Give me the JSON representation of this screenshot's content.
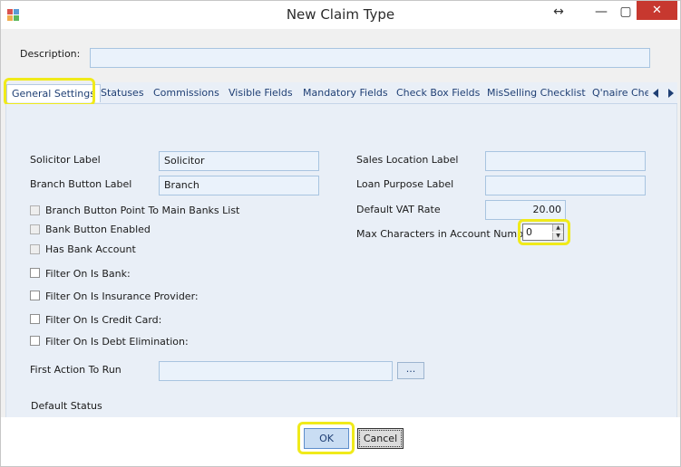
{
  "window": {
    "title": "New Claim Type",
    "resize_glyph": "↔",
    "minimize_glyph": "—",
    "maximize_glyph": "▢",
    "close_glyph": "✕"
  },
  "description": {
    "label": "Description:",
    "value": ""
  },
  "tabs": [
    {
      "label": "General Settings",
      "active": true
    },
    {
      "label": "Statuses"
    },
    {
      "label": "Commissions"
    },
    {
      "label": "Visible Fields"
    },
    {
      "label": "Mandatory Fields"
    },
    {
      "label": "Check Box Fields"
    },
    {
      "label": "MisSelling Checklist"
    },
    {
      "label": "Q'naire Chec"
    }
  ],
  "general": {
    "solicitor_label": {
      "label": "Solicitor Label",
      "value": "Solicitor"
    },
    "branch_button_label": {
      "label": "Branch Button Label",
      "value": "Branch"
    },
    "sales_location_label": {
      "label": "Sales Location Label",
      "value": ""
    },
    "loan_purpose_label": {
      "label": "Loan Purpose Label",
      "value": ""
    },
    "default_vat_rate": {
      "label": "Default VAT Rate",
      "value": "20.00"
    },
    "max_chars_account_number": {
      "label": "Max Characters in Account Number:",
      "value": "0"
    },
    "checkboxes": [
      {
        "label": "Branch Button Point To Main Banks List",
        "checked": false,
        "disabled": true
      },
      {
        "label": "Bank Button Enabled",
        "checked": false,
        "disabled": true
      },
      {
        "label": "Has Bank Account",
        "checked": false,
        "disabled": true
      },
      {
        "label": "Filter On Is Bank:",
        "checked": false,
        "disabled": false
      },
      {
        "label": "Filter On Is Insurance Provider:",
        "checked": false,
        "disabled": false
      },
      {
        "label": "Filter On Is Credit Card:",
        "checked": false,
        "disabled": false
      },
      {
        "label": "Filter On Is Debt Elimination:",
        "checked": false,
        "disabled": false
      }
    ],
    "first_action": {
      "label": "First Action To Run",
      "value": "",
      "browse_label": "..."
    },
    "default_status": {
      "label": "Default Status"
    }
  },
  "footer": {
    "ok_label": "OK",
    "cancel_label": "Cancel"
  },
  "colors": {
    "highlight": "#f0ea1a",
    "close_button": "#c7382f",
    "panel_bg": "#e9eff7"
  }
}
